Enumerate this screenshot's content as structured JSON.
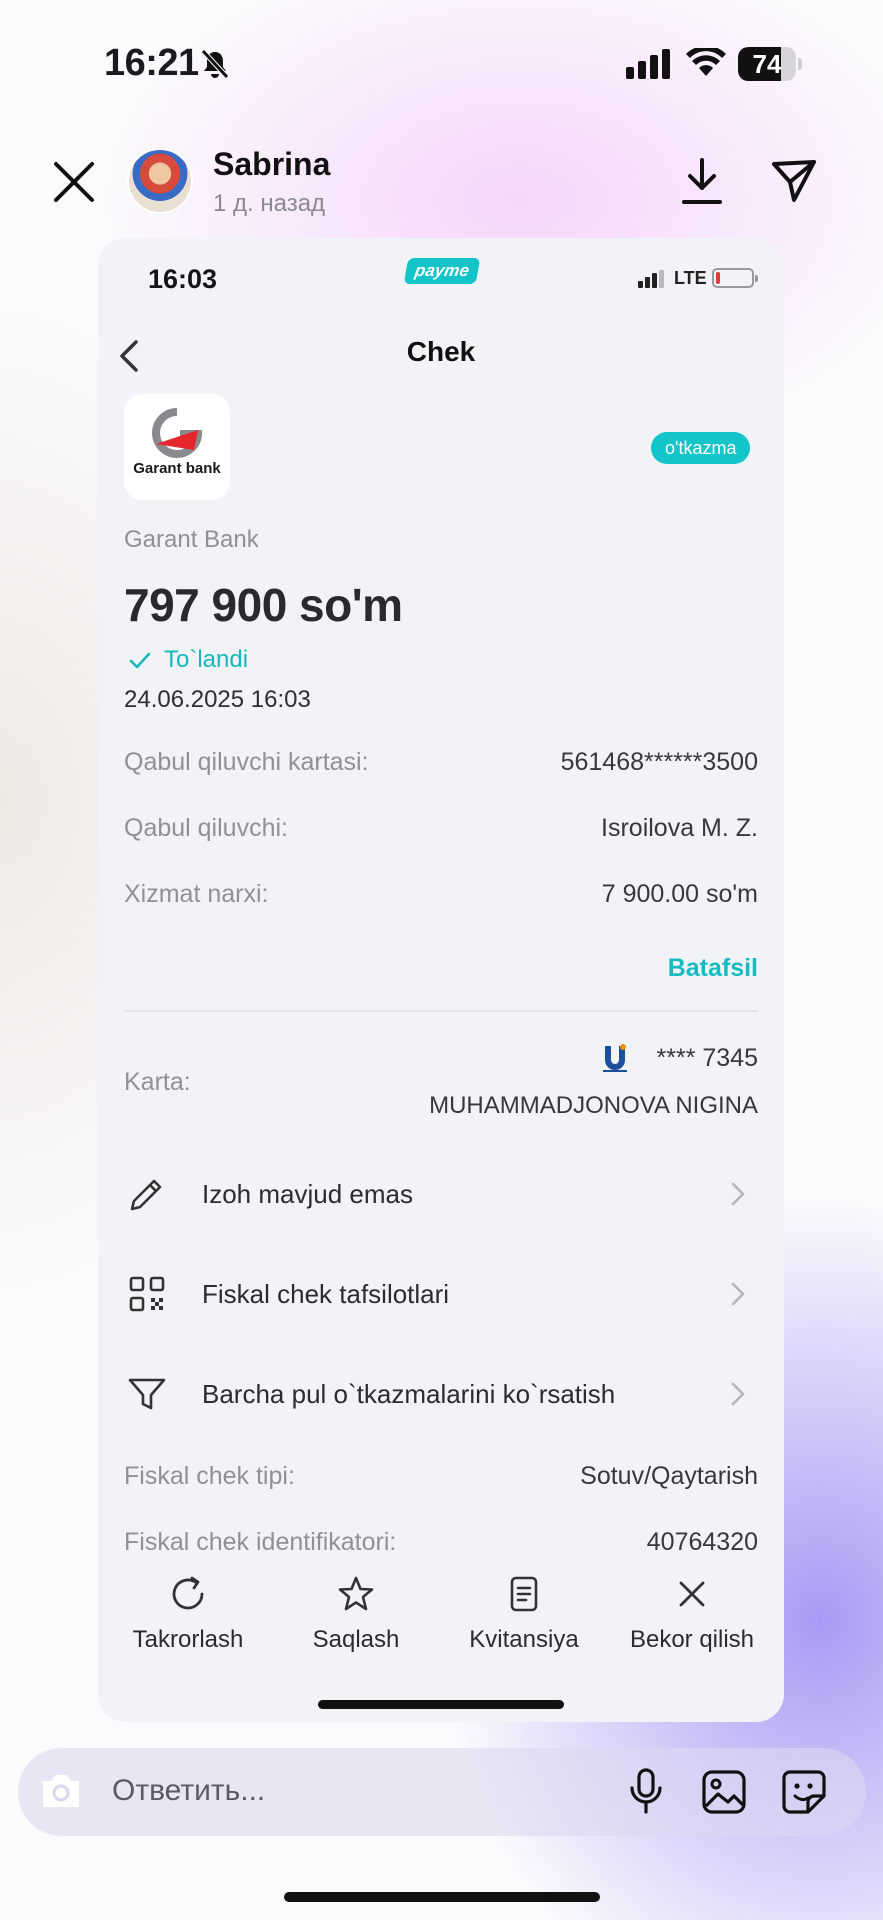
{
  "status_bar": {
    "time": "16:21",
    "battery": "74",
    "battery_level": 0.74
  },
  "story_header": {
    "user_name": "Sabrina",
    "posted_ago": "1 д. назад"
  },
  "receipt": {
    "inner_status": {
      "time": "16:03",
      "app_logo": "payme",
      "network": "LTE",
      "battery_level": 0.12
    },
    "title": "Chek",
    "bank_logo_text": "Garant bank",
    "badge": "o'tkazma",
    "bank_name": "Garant Bank",
    "amount": "797 900 so'm",
    "status": "To`landi",
    "datetime": "24.06.2025 16:03",
    "details": [
      {
        "label": "Qabul qiluvchi kartasi:",
        "value": "561468******3500"
      },
      {
        "label": "Qabul qiluvchi:",
        "value": "Isroilova M. Z."
      },
      {
        "label": "Xizmat narxi:",
        "value": "7 900.00 so'm"
      }
    ],
    "more_link": "Batafsil",
    "card": {
      "label": "Karta:",
      "number": "**** 7345",
      "owner": "MUHAMMADJONOVA NIGINA",
      "network_icon": "uzcard-icon"
    },
    "menu": [
      {
        "icon": "pencil-icon",
        "label": "Izoh mavjud emas"
      },
      {
        "icon": "qr-code-icon",
        "label": "Fiskal chek tafsilotlari"
      },
      {
        "icon": "filter-icon",
        "label": "Barcha pul o`tkazmalarini ko`rsatish"
      }
    ],
    "fiscal": [
      {
        "label": "Fiskal chek tipi:",
        "value": "Sotuv/Qaytarish"
      },
      {
        "label": "Fiskal chek identifikatori:",
        "value": "40764320"
      }
    ],
    "actions": [
      {
        "icon": "repeat-icon",
        "label": "Takrorlash"
      },
      {
        "icon": "star-icon",
        "label": "Saqlash"
      },
      {
        "icon": "receipt-icon",
        "label": "Kvitansiya"
      },
      {
        "icon": "close-icon",
        "label": "Bekor qilish"
      }
    ]
  },
  "reply_bar": {
    "placeholder": "Ответить..."
  },
  "colors": {
    "accent": "#13c4c9",
    "text": "#2b2b30",
    "muted": "#909197"
  }
}
